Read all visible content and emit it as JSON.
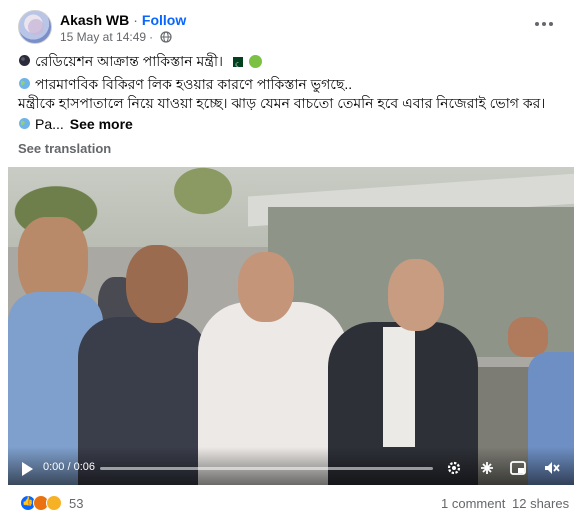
{
  "header": {
    "author": "Akash WB",
    "separator": "·",
    "follow_label": "Follow",
    "timestamp": "15 May at 14:49",
    "meta_separator": "·",
    "privacy_icon": "globe-icon",
    "more_icon": "more-options-icon"
  },
  "post": {
    "line1": "রেডিয়েশন আক্রান্ত পাকিস্তান মন্ত্রী।",
    "line2": "পারমাণবিক বিকিরণ লিক হওয়ার কারণে পাকিস্তান ভুগছে..",
    "line3": "মন্ত্রীকে হাসপাতালে নিয়ে যাওয়া হচ্ছে। ঝাড় যেমন বাচতো তেমনি হবে এবার নিজেরাই ভোগ কর।",
    "line4": "Pa...",
    "see_more": "See more",
    "see_translation": "See translation"
  },
  "video": {
    "time": "0:00 / 0:06",
    "progress": 0.0
  },
  "footer": {
    "reaction_count": "53",
    "comments": "1 comment",
    "shares": "12 shares"
  },
  "colors": {
    "accent": "#0866ff",
    "secondary_text": "#65676b",
    "primary_text": "#050505"
  }
}
